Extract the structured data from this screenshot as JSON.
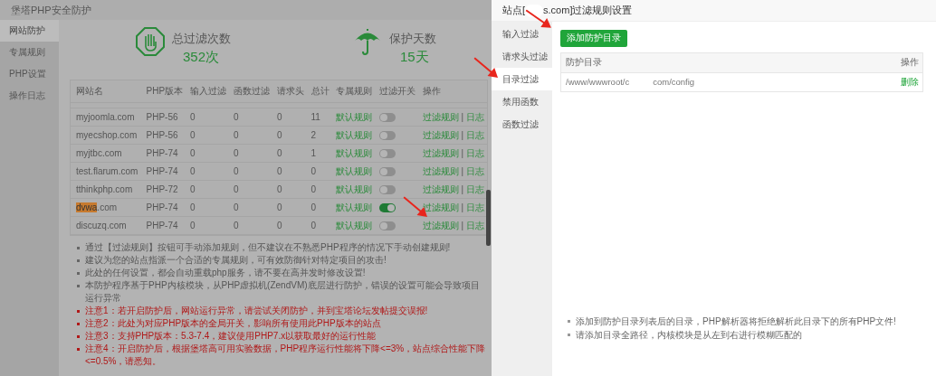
{
  "app": {
    "title": "堡塔PHP安全防护"
  },
  "sidebar": {
    "items": [
      {
        "label": "网站防护",
        "selected": true
      },
      {
        "label": "专属规则",
        "selected": false
      },
      {
        "label": "PHP设置",
        "selected": false
      },
      {
        "label": "操作日志",
        "selected": false
      }
    ]
  },
  "stats": [
    {
      "kind": "filter",
      "label": "总过滤次数",
      "value": "352次"
    },
    {
      "kind": "days",
      "label": "保护天数",
      "value": "15天"
    }
  ],
  "table": {
    "columns": [
      "网站名",
      "PHP版本",
      "输入过滤",
      "函数过滤",
      "请求头",
      "总计",
      "专属规则",
      "过滤开关",
      "操作"
    ],
    "rows": [
      {
        "name": "myjoomla.com",
        "php": "PHP-56",
        "input": "0",
        "func": "0",
        "header": "0",
        "total": "11",
        "rule": "默认规则",
        "on": false,
        "action_rule": "过滤规则",
        "action_sep": "|",
        "action_log": "日志"
      },
      {
        "name": "myecshop.com",
        "php": "PHP-56",
        "input": "0",
        "func": "0",
        "header": "0",
        "total": "2",
        "rule": "默认规则",
        "on": false,
        "action_rule": "过滤规则",
        "action_sep": "|",
        "action_log": "日志"
      },
      {
        "name": "myjtbc.com",
        "php": "PHP-74",
        "input": "0",
        "func": "0",
        "header": "0",
        "total": "1",
        "rule": "默认规则",
        "on": false,
        "action_rule": "过滤规则",
        "action_sep": "|",
        "action_log": "日志"
      },
      {
        "name": "test.flarum.com",
        "php": "PHP-74",
        "input": "0",
        "func": "0",
        "header": "0",
        "total": "0",
        "rule": "默认规则",
        "on": false,
        "action_rule": "过滤规则",
        "action_sep": "|",
        "action_log": "日志"
      },
      {
        "name": "tthinkphp.com",
        "php": "PHP-72",
        "input": "0",
        "func": "0",
        "header": "0",
        "total": "0",
        "rule": "默认规则",
        "on": false,
        "action_rule": "过滤规则",
        "action_sep": "|",
        "action_log": "日志"
      },
      {
        "name_marked": "dvwa",
        "name": ".com",
        "php": "PHP-74",
        "input": "0",
        "func": "0",
        "header": "0",
        "total": "0",
        "rule": "默认规则",
        "on": true,
        "action_rule": "过滤规则",
        "action_sep": "|",
        "action_log": "日志"
      },
      {
        "name": "discuzq.com",
        "php": "PHP-74",
        "input": "0",
        "func": "0",
        "header": "0",
        "total": "0",
        "rule": "默认规则",
        "on": false,
        "action_rule": "过滤规则",
        "action_sep": "|",
        "action_log": "日志"
      }
    ]
  },
  "notes": [
    {
      "text": "通过【过滤规则】按钮可手动添加规则，但不建议在不熟悉PHP程序的情况下手动创建规则!",
      "warning": false
    },
    {
      "text": "建议为您的站点指派一个合适的专属规则，可有效防御针对特定项目的攻击!",
      "warning": false
    },
    {
      "text": "此处的任何设置，都会自动重载php服务，请不要在高并发时修改设置!",
      "warning": false
    },
    {
      "text": "本防护程序基于PHP内核模块，从PHP虚拟机(ZendVM)底层进行防护，错误的设置可能会导致项目运行异常",
      "warning": false
    },
    {
      "text": "注意1：若开启防护后，网站运行异常，请尝试关闭防护，并到宝塔论坛发帖提交误报!",
      "warning": true
    },
    {
      "text": "注意2：此处为对应PHP版本的全局开关，影响所有使用此PHP版本的站点",
      "warning": true
    },
    {
      "text": "注意3：支持PHP版本：5.3-7.4，建议使用PHP7.x以获取最好的运行性能",
      "warning": true
    },
    {
      "text": "注意4：开启防护后，根据堡塔高可用实验数据，PHP程序运行性能将下降<=3%，站点综合性能下降<=0.5%，请悉知。",
      "warning": true
    }
  ],
  "dialog": {
    "title_prefix": "站点[",
    "title_suffix": "s.com]过滤规则设置",
    "nav": [
      {
        "label": "输入过滤",
        "selected": false
      },
      {
        "label": "请求头过滤",
        "selected": false
      },
      {
        "label": "目录过滤",
        "selected": true
      },
      {
        "label": "禁用函数",
        "selected": false
      },
      {
        "label": "函数过滤",
        "selected": false
      }
    ],
    "add_button": "添加防护目录",
    "table": {
      "columns": [
        "防护目录",
        "操作"
      ],
      "rows": [
        {
          "path_start": "/www/wwwroot/c",
          "path_end": "com/config",
          "action": "删除"
        }
      ]
    },
    "notes": [
      "添加到防护目录列表后的目录，PHP解析器将拒绝解析此目录下的所有PHP文件!",
      "请添加目录全路径，内核模块是从左到右进行模糊匹配的"
    ]
  }
}
